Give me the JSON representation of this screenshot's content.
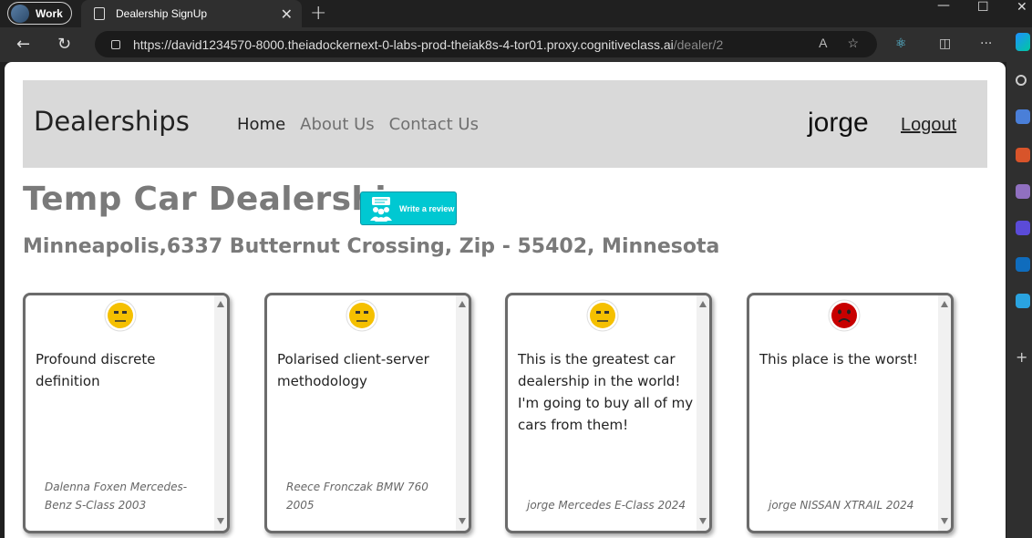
{
  "browser": {
    "profile_label": "Work",
    "tab_title": "Dealership SignUp",
    "url_host": "https://david1234570-8000.theiadockernext-0-labs-prod-theiak8s-4-tor01.proxy.cognitiveclass.ai",
    "url_path": "/dealer/2"
  },
  "navbar": {
    "brand": "Dealerships",
    "links": [
      "Home",
      "About Us",
      "Contact Us"
    ],
    "username": "jorge",
    "logout": "Logout"
  },
  "dealer": {
    "name": "Temp Car Dealership",
    "review_button": "Write a review",
    "address": "Minneapolis,6337 Butternut Crossing, Zip - 55402, Minnesota"
  },
  "reviews": [
    {
      "sentiment": "neutral",
      "text": "Profound discrete definition",
      "meta": "Dalenna Foxen Mercedes-Benz S-Class 2003"
    },
    {
      "sentiment": "neutral",
      "text": "Polarised client-server methodology",
      "meta": "Reece Fronczak BMW 760 2005"
    },
    {
      "sentiment": "neutral",
      "text": "This is the greatest car dealership in the world! I'm going to buy all of my cars from them!",
      "meta": "jorge Mercedes E-Class 2024"
    },
    {
      "sentiment": "negative",
      "text": "This place is the worst!",
      "meta": "jorge NISSAN XTRAIL 2024"
    }
  ],
  "colors": {
    "neutral_face": "#f5c000",
    "negative_face": "#c80000",
    "review_button": "#00c8d2"
  }
}
